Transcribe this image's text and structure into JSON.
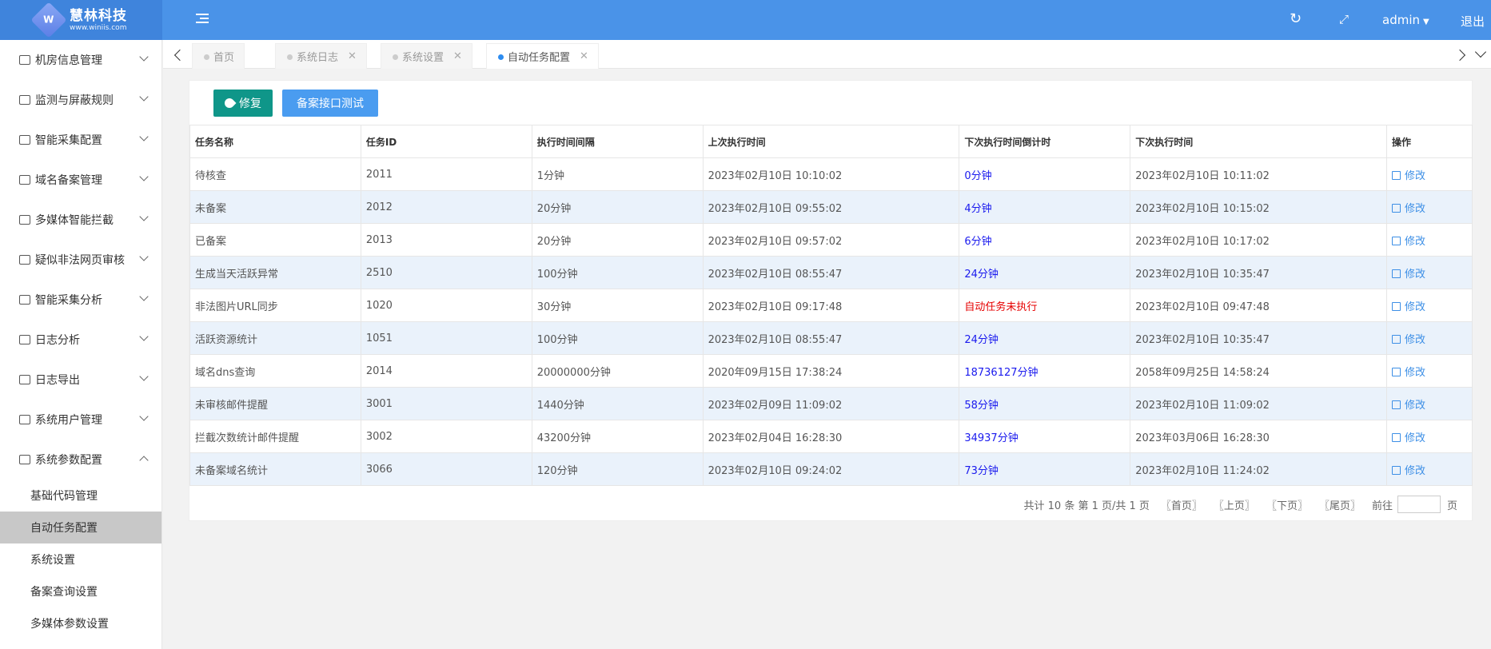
{
  "header": {
    "logo_name": "慧林科技",
    "logo_url": "www.winiis.com",
    "logo_badge": "W",
    "user": "admin",
    "logout": "退出"
  },
  "sidebar": {
    "items": [
      {
        "label": "机房信息管理"
      },
      {
        "label": "监测与屏蔽规则"
      },
      {
        "label": "智能采集配置"
      },
      {
        "label": "域名备案管理"
      },
      {
        "label": "多媒体智能拦截"
      },
      {
        "label": "疑似非法网页审核"
      },
      {
        "label": "智能采集分析"
      },
      {
        "label": "日志分析"
      },
      {
        "label": "日志导出"
      },
      {
        "label": "系统用户管理"
      },
      {
        "label": "系统参数配置"
      }
    ],
    "sub_items": [
      {
        "label": "基础代码管理"
      },
      {
        "label": "自动任务配置"
      },
      {
        "label": "系统设置"
      },
      {
        "label": "备案查询设置"
      },
      {
        "label": "多媒体参数设置"
      }
    ]
  },
  "tabs": [
    {
      "label": "首页"
    },
    {
      "label": "系统日志"
    },
    {
      "label": "系统设置"
    },
    {
      "label": "自动任务配置"
    }
  ],
  "toolbar": {
    "repair": "修复",
    "test": "备案接口测试"
  },
  "table": {
    "headers": [
      "任务名称",
      "任务ID",
      "执行时间间隔",
      "上次执行时间",
      "下次执行时间倒计时",
      "下次执行时间",
      "操作"
    ],
    "edit_label": "修改",
    "rows": [
      {
        "name": "待核查",
        "id": "2011",
        "interval": "1分钟",
        "last": "2023年02月10日 10:10:02",
        "countdown": "0分钟",
        "next": "2023年02月10日 10:11:02"
      },
      {
        "name": "未备案",
        "id": "2012",
        "interval": "20分钟",
        "last": "2023年02月10日 09:55:02",
        "countdown": "4分钟",
        "next": "2023年02月10日 10:15:02"
      },
      {
        "name": "已备案",
        "id": "2013",
        "interval": "20分钟",
        "last": "2023年02月10日 09:57:02",
        "countdown": "6分钟",
        "next": "2023年02月10日 10:17:02"
      },
      {
        "name": "生成当天活跃异常",
        "id": "2510",
        "interval": "100分钟",
        "last": "2023年02月10日 08:55:47",
        "countdown": "24分钟",
        "next": "2023年02月10日 10:35:47"
      },
      {
        "name": "非法图片URL同步",
        "id": "1020",
        "interval": "30分钟",
        "last": "2023年02月10日 09:17:48",
        "countdown": "自动任务未执行",
        "next": "2023年02月10日 09:47:48"
      },
      {
        "name": "活跃资源统计",
        "id": "1051",
        "interval": "100分钟",
        "last": "2023年02月10日 08:55:47",
        "countdown": "24分钟",
        "next": "2023年02月10日 10:35:47"
      },
      {
        "name": "域名dns查询",
        "id": "2014",
        "interval": "20000000分钟",
        "last": "2020年09月15日 17:38:24",
        "countdown": "18736127分钟",
        "next": "2058年09月25日 14:58:24"
      },
      {
        "name": "未审核邮件提醒",
        "id": "3001",
        "interval": "1440分钟",
        "last": "2023年02月09日 11:09:02",
        "countdown": "58分钟",
        "next": "2023年02月10日 11:09:02"
      },
      {
        "name": "拦截次数统计邮件提醒",
        "id": "3002",
        "interval": "43200分钟",
        "last": "2023年02月04日 16:28:30",
        "countdown": "34937分钟",
        "next": "2023年03月06日 16:28:30"
      },
      {
        "name": "未备案域名统计",
        "id": "3066",
        "interval": "120分钟",
        "last": "2023年02月10日 09:24:02",
        "countdown": "73分钟",
        "next": "2023年02月10日 11:24:02"
      }
    ]
  },
  "pager": {
    "summary": "共计 10 条 第 1 页/共 1 页",
    "first": "〖首页〗",
    "prev": "〖上页〗",
    "next": "〖下页〗",
    "last": "〖尾页〗",
    "goto": "前往",
    "page_unit": "页"
  },
  "colors": {
    "header": "#4a93e8",
    "repair_button": "#0f9689",
    "test_button": "#4a9cf0",
    "countdown": "#1a1aee",
    "warning": "#e60000"
  }
}
